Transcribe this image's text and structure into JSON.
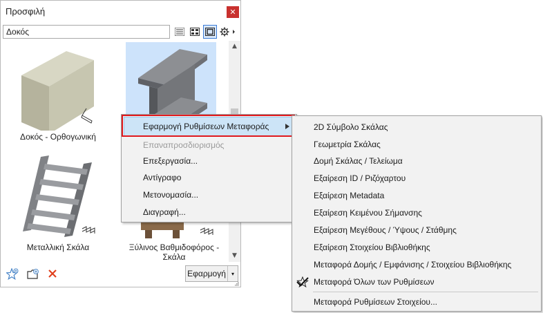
{
  "palette": {
    "title": "Προσφιλή",
    "close_glyph": "✕",
    "search_value": "Δοκός",
    "view_buttons": [
      "list-view-icon",
      "small-grid-view-icon",
      "large-preview-view-icon",
      "gear-icon"
    ],
    "items": [
      {
        "label": "Δοκός - Ορθογωνική",
        "icon": "rectangular-beam"
      },
      {
        "label": "",
        "icon": "steel-i-beam",
        "selected": true
      },
      {
        "label": "Μεταλλική Σκάλα",
        "icon": "metal-stair"
      },
      {
        "label": "Ξύλινος Βαθμιδοφόρος - Σκάλα",
        "icon": "wooden-stringer-stair"
      }
    ],
    "bottom": {
      "add_favorite_icon": "star-add-icon",
      "new_folder_icon": "folder-add-icon",
      "delete_icon": "delete-x-icon",
      "apply_label": "Εφαρμογή",
      "apply_dropdown_glyph": "▾"
    }
  },
  "context_menu": {
    "items": [
      {
        "label": "Εφαρμογή Ρυθμίσεων Μεταφοράς",
        "has_submenu": true,
        "highlighted": true
      },
      {
        "label": "Επαναπροσδιορισμός",
        "disabled": true
      },
      {
        "label": "Επεξεργασία..."
      },
      {
        "label": "Αντίγραφο"
      },
      {
        "label": "Μετονομασία..."
      },
      {
        "label": "Διαγραφή..."
      }
    ],
    "submenu": [
      {
        "label": "2D Σύμβολο Σκάλας"
      },
      {
        "label": "Γεωμετρία Σκάλας"
      },
      {
        "label": "Δομή Σκάλας / Τελείωμα"
      },
      {
        "label": "Εξαίρεση ID / Ριζόχαρτου"
      },
      {
        "label": "Εξαίρεση Metadata"
      },
      {
        "label": "Εξαίρεση Κειμένου Σήμανσης"
      },
      {
        "label": "Εξαίρεση Μεγέθους / Ύψους / Στάθμης"
      },
      {
        "label": "Εξαίρεση Στοιχείου Βιβλιοθήκης"
      },
      {
        "label": "Μεταφορά Δομής / Εμφάνισης / Στοιχείου Βιβλιοθήκης"
      },
      {
        "label": "Μεταφορά Όλων των Ρυθμίσεων",
        "checked": true
      },
      {
        "label": "Μεταφορά Ρυθμίσεων Στοιχείου..."
      }
    ]
  },
  "colors": {
    "close_red": "#c9312e",
    "highlight_red_outline": "#e0191e",
    "selection_blue": "#cde3fb",
    "menu_highlight": "#cce4f7"
  }
}
